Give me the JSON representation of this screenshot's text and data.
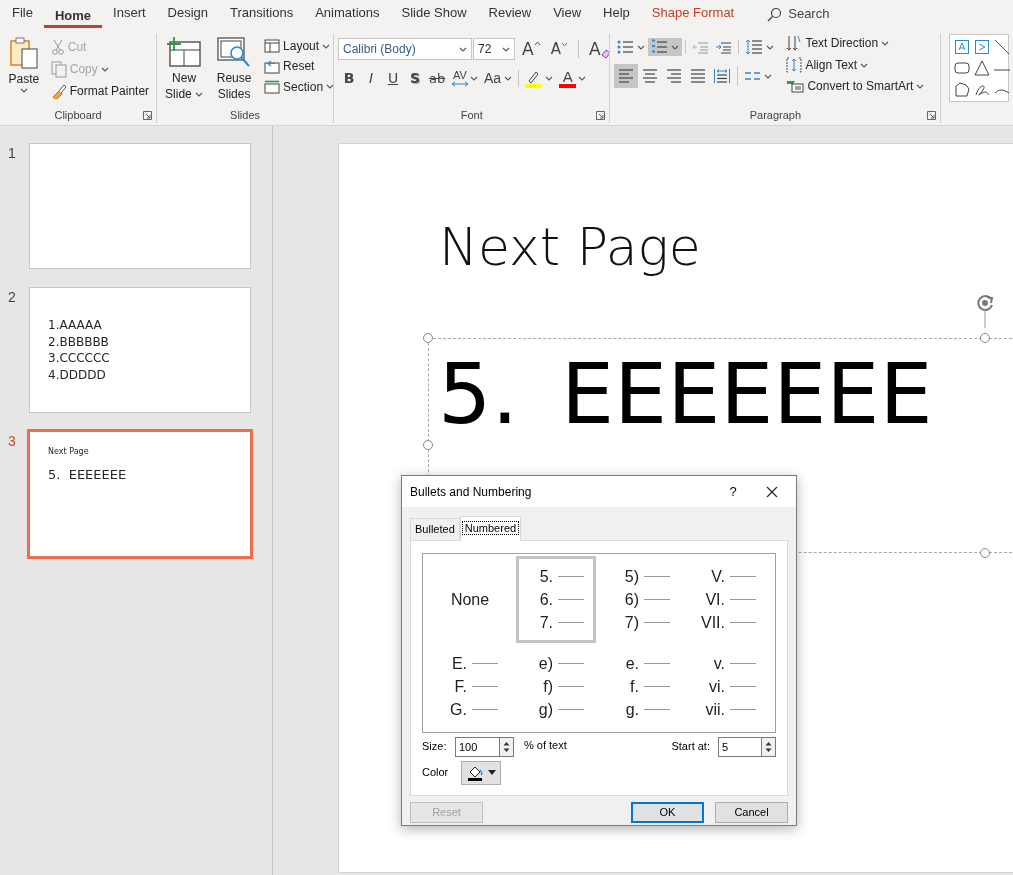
{
  "ribbon_tabs": [
    {
      "label": "File",
      "selected": false,
      "kind": "standard"
    },
    {
      "label": "Home",
      "selected": true,
      "kind": "standard"
    },
    {
      "label": "Insert",
      "selected": false,
      "kind": "standard"
    },
    {
      "label": "Design",
      "selected": false,
      "kind": "standard"
    },
    {
      "label": "Transitions",
      "selected": false,
      "kind": "standard"
    },
    {
      "label": "Animations",
      "selected": false,
      "kind": "standard"
    },
    {
      "label": "Slide Show",
      "selected": false,
      "kind": "standard"
    },
    {
      "label": "Review",
      "selected": false,
      "kind": "standard"
    },
    {
      "label": "View",
      "selected": false,
      "kind": "standard"
    },
    {
      "label": "Help",
      "selected": false,
      "kind": "standard"
    },
    {
      "label": "Shape Format",
      "selected": false,
      "kind": "contextual"
    }
  ],
  "search": {
    "placeholder": "Search"
  },
  "clipboard": {
    "title": "Clipboard",
    "paste": "Paste",
    "cut": {
      "label": "Cut",
      "disabled": true
    },
    "copy": {
      "label": "Copy",
      "disabled": true
    },
    "format_painter": {
      "label": "Format Painter",
      "disabled": false
    }
  },
  "slides_group": {
    "title": "Slides",
    "new_slide": "New Slide",
    "reuse_slides": "Reuse Slides",
    "layout": "Layout",
    "reset": "Reset",
    "section": "Section"
  },
  "font": {
    "title": "Font",
    "font_name": "Calibri (Body)",
    "font_size": "72",
    "grow": "A",
    "shrink": "A",
    "clear": "A",
    "styles": [
      {
        "kind": "bold",
        "label": "B"
      },
      {
        "kind": "italic",
        "label": "I"
      },
      {
        "kind": "underline",
        "label": "U"
      },
      {
        "kind": "shadow",
        "label": "S"
      },
      {
        "kind": "strike",
        "label": "ab"
      }
    ],
    "spacing": "AV",
    "change_case": "Aa",
    "font_color": "A"
  },
  "paragraph": {
    "title": "Paragraph",
    "list_buttons": [
      {
        "kind": "bullets",
        "selected": false
      },
      {
        "kind": "numbering",
        "selected": true
      }
    ],
    "align_buttons": [
      {
        "kind": "left",
        "selected": true
      },
      {
        "kind": "center",
        "selected": false
      },
      {
        "kind": "right",
        "selected": false
      },
      {
        "kind": "justify",
        "selected": false
      },
      {
        "kind": "distributed",
        "selected": false
      }
    ],
    "text_direction": "Text Direction",
    "align_text": "Align Text",
    "convert": "Convert to SmartArt"
  },
  "thumbnails": [
    {
      "number": "1",
      "selected": false
    },
    {
      "number": "2",
      "selected": false,
      "body": [
        "1.AAAAA",
        "2.BBBBBB",
        "3.CCCCCC",
        "4.DDDDD"
      ]
    },
    {
      "number": "3",
      "selected": true,
      "title": "Next Page",
      "body": [
        "5.  EEEEEEE"
      ]
    }
  ],
  "slide": {
    "title": "Next Page",
    "number": "5.",
    "text": "EEEEEEE"
  },
  "dialog": {
    "title": "Bullets and Numbering",
    "help": "?",
    "tabs": [
      {
        "label": "Bulleted",
        "selected": false
      },
      {
        "label": "Numbered",
        "selected": true
      }
    ],
    "styles": [
      {
        "kind": "none",
        "label": "None",
        "selected": false
      },
      {
        "kind": "list",
        "items": [
          "5.",
          "6.",
          "7."
        ],
        "selected": true
      },
      {
        "kind": "list",
        "items": [
          "5)",
          "6)",
          "7)"
        ],
        "selected": false
      },
      {
        "kind": "list",
        "items": [
          "V.",
          "VI.",
          "VII."
        ],
        "selected": false
      },
      {
        "kind": "list",
        "items": [
          "E.",
          "F.",
          "G."
        ],
        "selected": false
      },
      {
        "kind": "list",
        "items": [
          "e)",
          "f)",
          "g)"
        ],
        "selected": false
      },
      {
        "kind": "list",
        "items": [
          "e.",
          "f.",
          "g."
        ],
        "selected": false
      },
      {
        "kind": "list",
        "items": [
          "v.",
          "vi.",
          "vii."
        ],
        "selected": false
      }
    ],
    "size": {
      "label": "Size:",
      "value": "100",
      "unit": "% of text"
    },
    "start_at": {
      "label": "Start at:",
      "value": "5"
    },
    "color_label": "Color",
    "buttons": [
      {
        "label": "Reset",
        "kind": "normal",
        "disabled": true
      },
      {
        "label": "OK",
        "kind": "default",
        "disabled": false
      },
      {
        "label": "Cancel",
        "kind": "normal",
        "disabled": false
      }
    ]
  }
}
